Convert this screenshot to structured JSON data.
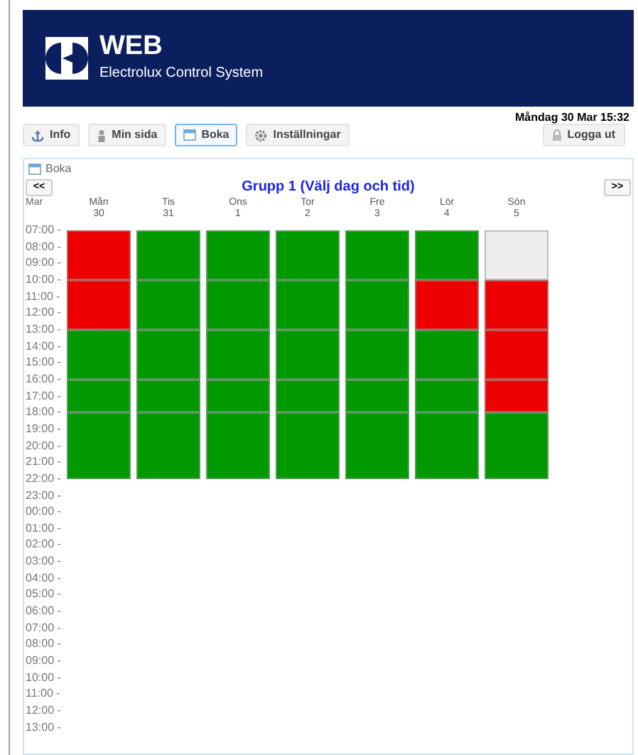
{
  "header": {
    "title": "WEB",
    "subtitle": "Electrolux Control System"
  },
  "datetime": "Måndag 30 Mar 15:32",
  "nav": [
    {
      "label": "Info",
      "selected": false
    },
    {
      "label": "Min sida",
      "selected": false
    },
    {
      "label": "Boka",
      "selected": true
    },
    {
      "label": "Inställningar",
      "selected": false
    }
  ],
  "logout": "Logga ut",
  "panel": {
    "title": "Boka",
    "prev": "<<",
    "next": ">>",
    "heading": "Grupp 1 (Välj dag och tid)",
    "month": "Mar",
    "days": [
      {
        "name": "Mån",
        "date": "30",
        "slots": [
          {
            "kind": "booked"
          },
          {
            "kind": "booked"
          },
          {
            "kind": "free"
          },
          {
            "kind": "free"
          },
          {
            "kind": "free"
          }
        ]
      },
      {
        "name": "Tis",
        "date": "31",
        "slots": [
          {
            "kind": "free"
          },
          {
            "kind": "free"
          },
          {
            "kind": "free"
          },
          {
            "kind": "free"
          },
          {
            "kind": "free"
          }
        ]
      },
      {
        "name": "Ons",
        "date": "1",
        "slots": [
          {
            "kind": "free"
          },
          {
            "kind": "free"
          },
          {
            "kind": "free"
          },
          {
            "kind": "free"
          },
          {
            "kind": "free"
          }
        ]
      },
      {
        "name": "Tor",
        "date": "2",
        "slots": [
          {
            "kind": "free"
          },
          {
            "kind": "free"
          },
          {
            "kind": "free"
          },
          {
            "kind": "free"
          },
          {
            "kind": "free"
          }
        ]
      },
      {
        "name": "Fre",
        "date": "3",
        "slots": [
          {
            "kind": "free"
          },
          {
            "kind": "free"
          },
          {
            "kind": "free"
          },
          {
            "kind": "free"
          },
          {
            "kind": "free"
          }
        ]
      },
      {
        "name": "Lör",
        "date": "4",
        "slots": [
          {
            "kind": "free"
          },
          {
            "kind": "booked"
          },
          {
            "kind": "free"
          },
          {
            "kind": "free"
          },
          {
            "kind": "free"
          }
        ]
      },
      {
        "name": "Sön",
        "date": "5",
        "slots": [
          {
            "kind": "unavailable"
          },
          {
            "kind": "booked"
          },
          {
            "kind": "booked"
          },
          {
            "kind": "booked"
          },
          {
            "kind": "free"
          }
        ]
      }
    ],
    "times": [
      "07:00 -",
      "08:00 -",
      "09:00 -",
      "10:00 -",
      "11:00 -",
      "12:00 -",
      "13:00 -",
      "14:00 -",
      "15:00 -",
      "16:00 -",
      "17:00 -",
      "18:00 -",
      "19:00 -",
      "20:00 -",
      "21:00 -",
      "22:00 -",
      "23:00 -",
      "00:00 -",
      "01:00 -",
      "02:00 -",
      "03:00 -",
      "04:00 -",
      "05:00 -",
      "06:00 -",
      "07:00 -",
      "08:00 -",
      "09:00 -",
      "10:00 -",
      "11:00 -",
      "12:00 -",
      "13:00 -"
    ]
  }
}
